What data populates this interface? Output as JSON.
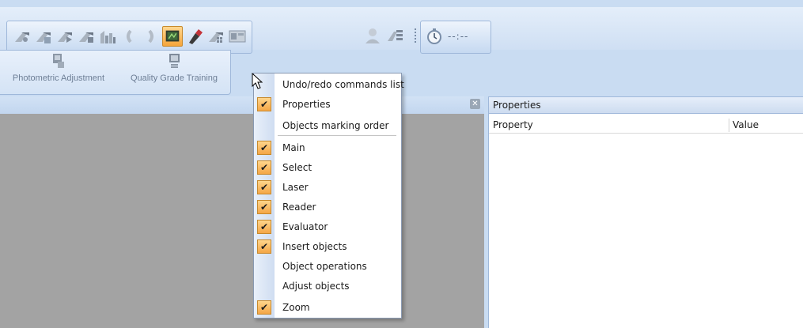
{
  "toolbar": {
    "icons": [
      {
        "name": "mark-icon"
      },
      {
        "name": "mark-select-icon"
      },
      {
        "name": "mark-play-icon"
      },
      {
        "name": "mark-stop-icon"
      },
      {
        "name": "mark-chart-icon"
      },
      {
        "name": "bracket-left-icon"
      },
      {
        "name": "bracket-right-icon"
      },
      {
        "name": "monitor-icon",
        "active": true
      },
      {
        "name": "pen-icon"
      },
      {
        "name": "mark-grid-icon"
      },
      {
        "name": "panel-icon"
      },
      {
        "name": "user-icon"
      },
      {
        "name": "mark-list-icon"
      }
    ],
    "timer_text": "--:--",
    "accent_color": "#f5a43a"
  },
  "ribbon": {
    "buttons": [
      {
        "label": "Photometric Adjustment"
      },
      {
        "label": "Quality Grade Training"
      }
    ]
  },
  "properties": {
    "title": "Properties",
    "columns": [
      "Property",
      "Value"
    ]
  },
  "menu": {
    "items": [
      {
        "label": "Undo/redo commands list",
        "checked": false
      },
      {
        "label": "Properties",
        "checked": true
      },
      {
        "label": "Objects marking order",
        "checked": false
      },
      {
        "label": "Main",
        "checked": true
      },
      {
        "label": "Select",
        "checked": true
      },
      {
        "label": "Laser",
        "checked": true
      },
      {
        "label": "Reader",
        "checked": true
      },
      {
        "label": "Evaluator",
        "checked": true
      },
      {
        "label": "Insert objects",
        "checked": true
      },
      {
        "label": "Object operations",
        "checked": false
      },
      {
        "label": "Adjust objects",
        "checked": false
      },
      {
        "label": "Zoom",
        "checked": true
      }
    ]
  }
}
